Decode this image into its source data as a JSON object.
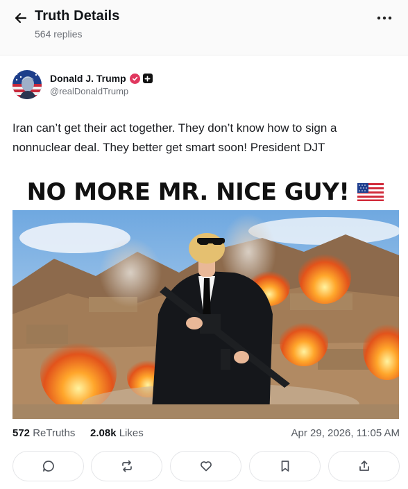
{
  "header": {
    "title": "Truth Details",
    "replies": "564 replies"
  },
  "author": {
    "name": "Donald J. Trump",
    "handle": "@realDonaldTrump"
  },
  "post": {
    "text": "Iran can’t get their act together. They don’t know how to sign a nonnuclear deal. They better get smart soon! President DJT",
    "image_headline": "NO MORE MR. NICE GUY!"
  },
  "stats": {
    "retruths_count": "572",
    "retruths_label": "ReTruths",
    "likes_count": "2.08k",
    "likes_label": "Likes",
    "timestamp": "Apr 29, 2026, 11:05 AM"
  },
  "icons": {
    "back": "arrow-left-icon",
    "more": "more-dots-icon",
    "reply": "comment-icon",
    "retruth": "repost-icon",
    "like": "heart-icon",
    "bookmark": "bookmark-icon",
    "share": "share-icon"
  },
  "colors": {
    "verified_badge": "#e0375e",
    "muted_text": "#6b6f76"
  }
}
